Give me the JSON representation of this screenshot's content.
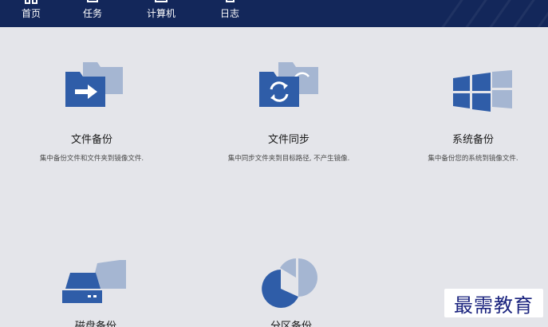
{
  "colors": {
    "topbar": "#13275a",
    "background": "#e4e5ea",
    "icon_dark": "#2f5da8",
    "icon_light": "#a5b6d2",
    "watermark_text": "#1a237e"
  },
  "nav": {
    "items": [
      {
        "label": "首页",
        "icon": "home-icon"
      },
      {
        "label": "任务",
        "icon": "tasks-icon"
      },
      {
        "label": "计算机",
        "icon": "computer-icon"
      },
      {
        "label": "日志",
        "icon": "log-icon"
      }
    ]
  },
  "cards": {
    "file_backup": {
      "title": "文件备份",
      "desc": "集中备份文件和文件夹到镜像文件.",
      "icon": "folder-arrow-icon"
    },
    "file_sync": {
      "title": "文件同步",
      "desc": "集中同步文件夹到目标路径, 不产生镜像.",
      "icon": "folder-sync-icon"
    },
    "system_backup": {
      "title": "系统备份",
      "desc": "集中备份您的系统到镜像文件.",
      "icon": "windows-icon"
    },
    "disk_backup": {
      "title": "磁盘备份",
      "icon": "disk-icon"
    },
    "partition_backup": {
      "title": "分区备份",
      "icon": "pie-icon"
    }
  },
  "watermark": {
    "text": "最需教育"
  }
}
